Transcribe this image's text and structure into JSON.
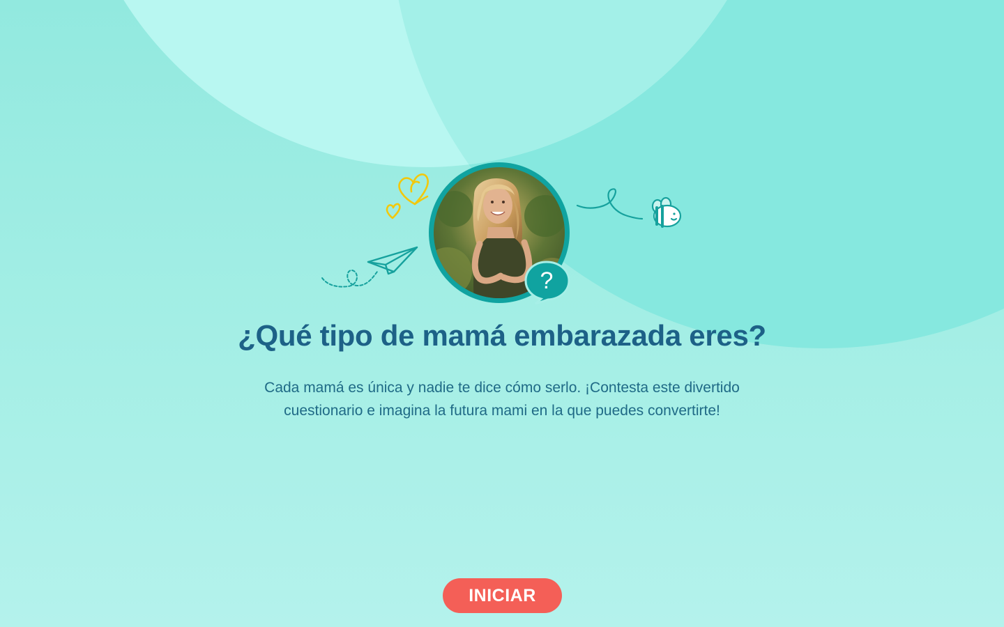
{
  "quiz": {
    "title": "¿Qué tipo de mamá embarazada eres?",
    "description": "Cada mamá es única y nadie te dice cómo serlo. ¡Contesta este divertido cuestionario e imagina la futura mami en la que puedes convertirte!",
    "start_label": "INICIAR",
    "question_mark": "?"
  },
  "colors": {
    "accent_teal": "#10a3a0",
    "title_blue": "#1d6187",
    "button_red": "#f45f57",
    "doodle_yellow": "#f2c80c"
  },
  "icons": [
    "hearts-icon",
    "paper-plane-icon",
    "bee-icon",
    "question-bubble-icon"
  ]
}
